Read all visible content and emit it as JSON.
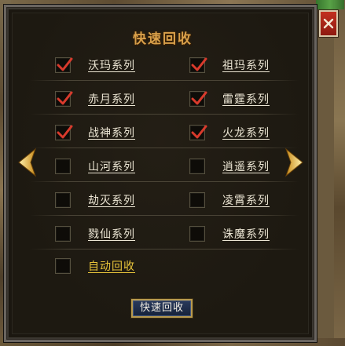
{
  "dialog": {
    "title": "快速回收",
    "close_symbol": "✕"
  },
  "items": [
    {
      "label": "沃玛系列",
      "checked": true
    },
    {
      "label": "祖玛系列",
      "checked": true
    },
    {
      "label": "赤月系列",
      "checked": true
    },
    {
      "label": "雷霆系列",
      "checked": true
    },
    {
      "label": "战神系列",
      "checked": true
    },
    {
      "label": "火龙系列",
      "checked": true
    },
    {
      "label": "山河系列",
      "checked": false
    },
    {
      "label": "逍遥系列",
      "checked": false
    },
    {
      "label": "劫灭系列",
      "checked": false
    },
    {
      "label": "凌霄系列",
      "checked": false
    },
    {
      "label": "戮仙系列",
      "checked": false
    },
    {
      "label": "诛魔系列",
      "checked": false
    }
  ],
  "auto_recycle": {
    "label": "自动回收",
    "checked": false
  },
  "actions": {
    "recycle_button_label": "快速回收"
  },
  "icons": {
    "prev": "chevron-left-icon",
    "next": "chevron-right-icon",
    "check": "checkmark-icon",
    "close": "close-icon"
  },
  "colors": {
    "title": "#d9a04a",
    "check": "#d83a2c",
    "auto_label": "#e8c43a",
    "close_bg": "#b02818",
    "arrow": "#f0c24a"
  }
}
